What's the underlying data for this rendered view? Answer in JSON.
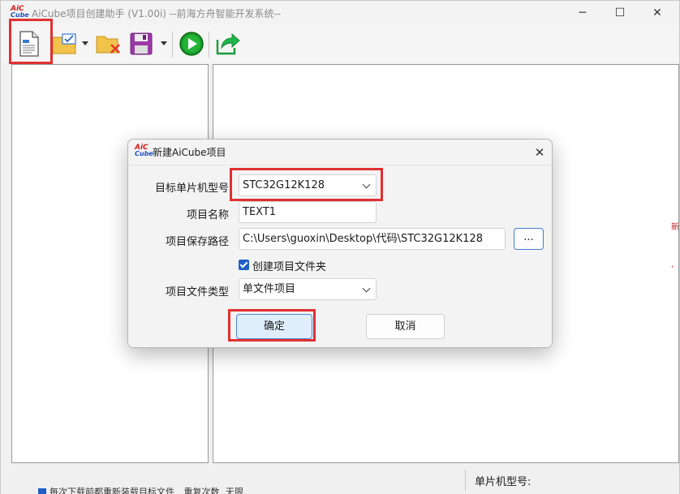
{
  "window": {
    "title": "AiCube项目创建助手 (V1.00i) --前海方舟智能开发系统--",
    "logo_top": "AiC",
    "logo_bottom": "Cube",
    "minimize_icon": "─",
    "maximize_icon": "☐",
    "close_icon": "✕"
  },
  "toolbar": {
    "icons": [
      "new-project-icon",
      "open-folder-icon",
      "close-project-icon",
      "save-icon",
      "run-icon",
      "export-icon"
    ]
  },
  "statusbar": {
    "mcu_label": "单片机型号:"
  },
  "bottom_strip": {
    "check_text": "每次下载前都重新装载目标文件",
    "repeat_label": "重复次数",
    "repeat_value": "无限"
  },
  "dialog": {
    "title": "新建AiCube项目",
    "close_icon": "✕",
    "logo_top": "AiC",
    "logo_bottom": "Cube",
    "mcu_label": "目标单片机型号",
    "mcu_value": "STC32G12K128",
    "name_label": "项目名称",
    "name_value": "TEXT1",
    "path_label": "项目保存路径",
    "path_value": "C:\\Users\\guoxin\\Desktop\\代码\\STC32G12K128",
    "browse_label": "...",
    "create_folder_label": "创建项目文件夹",
    "create_folder_checked": true,
    "type_label": "项目文件类型",
    "type_value": "单文件项目",
    "ok_label": "确定",
    "cancel_label": "取消"
  },
  "colors": {
    "highlight": "#e03030",
    "accent": "#1f5fc7"
  }
}
